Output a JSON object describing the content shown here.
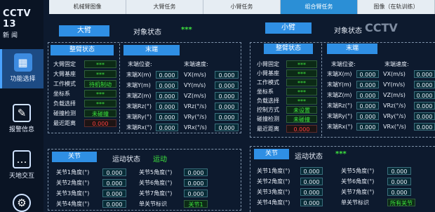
{
  "tabs": [
    "机械臂图像",
    "大臂任务",
    "小臂任务",
    "组合臂任务",
    "图像（在轨训练）"
  ],
  "tab_active_index": 3,
  "logo": {
    "main": "CCTV 13",
    "sub": "新闻"
  },
  "sidebar": [
    {
      "label": "功能选择",
      "icon": "grid-icon"
    },
    {
      "label": "报警信息",
      "icon": "document-icon"
    },
    {
      "label": "天地交互",
      "icon": "chat-icon"
    },
    {
      "label": "",
      "icon": "gear-icon"
    }
  ],
  "watermark": "CCTV",
  "big_arm": {
    "name": "大臂",
    "object_status_label": "对象状态",
    "object_status_value": "***",
    "whole_status": {
      "title": "整臂状态",
      "rows": [
        {
          "label": "大臂固定",
          "value": "***"
        },
        {
          "label": "大臂基座",
          "value": "***"
        },
        {
          "label": "工作模式",
          "value": "待机制动"
        },
        {
          "label": "坐标系",
          "value": "***"
        },
        {
          "label": "负载选择",
          "value": "***"
        },
        {
          "label": "碰撞检测",
          "value": "未碰撞"
        },
        {
          "label": "最近距离",
          "value": "0.000"
        }
      ]
    },
    "end": {
      "title": "末端",
      "pos_title": "末端位姿:",
      "vel_title": "末端速度:",
      "pos": [
        {
          "label": "末端X(m)",
          "value": "0.000"
        },
        {
          "label": "末端Y(m)",
          "value": "0.000"
        },
        {
          "label": "末端Z(m)",
          "value": "0.000"
        },
        {
          "label": "末端Rz(°)",
          "value": "0.000"
        },
        {
          "label": "末端Ry(°)",
          "value": "0.000"
        },
        {
          "label": "末端Rx(°)",
          "value": "0.000"
        }
      ],
      "vel": [
        {
          "label": "VX(m/s)",
          "value": "0.000"
        },
        {
          "label": "VY(m/s)",
          "value": "0.000"
        },
        {
          "label": "VZ(m/s)",
          "value": "0.000"
        },
        {
          "label": "VRz(°/s)",
          "value": "0.000"
        },
        {
          "label": "VRy(°/s)",
          "value": "0.000"
        },
        {
          "label": "VRx(°/s)",
          "value": "0.000"
        }
      ]
    },
    "joint": {
      "title": "关节",
      "motion_label": "运动状态",
      "motion_value": "运动",
      "left": [
        {
          "label": "关节1角度(°)",
          "value": "0.000"
        },
        {
          "label": "关节2角度(°)",
          "value": "0.000"
        },
        {
          "label": "关节3角度(°)",
          "value": "0.000"
        },
        {
          "label": "关节4角度(°)",
          "value": "0.000"
        }
      ],
      "right": [
        {
          "label": "关节5角度(°)",
          "value": "0.000"
        },
        {
          "label": "关节6角度(°)",
          "value": "0.000"
        },
        {
          "label": "关节7角度(°)",
          "value": "0.000"
        },
        {
          "label": "单关节标识",
          "value": "关节1"
        }
      ]
    }
  },
  "small_arm": {
    "name": "小臂",
    "object_status_label": "对象状态",
    "object_status_value": "***",
    "whole_status": {
      "title": "整臂状态",
      "rows": [
        {
          "label": "小臂固定",
          "value": "***"
        },
        {
          "label": "小臂基座",
          "value": "***"
        },
        {
          "label": "工作模式",
          "value": "***"
        },
        {
          "label": "坐标系",
          "value": "***"
        },
        {
          "label": "负载选择",
          "value": "***"
        },
        {
          "label": "控制方式",
          "value": "未设置"
        },
        {
          "label": "碰撞检测",
          "value": "未碰撞"
        },
        {
          "label": "最近距离",
          "value": "0.000"
        }
      ]
    },
    "end": {
      "title": "末端",
      "pos_title": "末端位姿:",
      "vel_title": "末端速度:",
      "pos": [
        {
          "label": "末端X(m)",
          "value": "0.000"
        },
        {
          "label": "末端Y(m)",
          "value": "0.000"
        },
        {
          "label": "末端Z(m)",
          "value": "0.000"
        },
        {
          "label": "末端Rz(°)",
          "value": "0.000"
        },
        {
          "label": "末端Ry(°)",
          "value": "0.000"
        },
        {
          "label": "末端Rx(°)",
          "value": "0.000"
        }
      ],
      "vel": [
        {
          "label": "VX(m/s)",
          "value": "0.000"
        },
        {
          "label": "VY(m/s)",
          "value": "0.000"
        },
        {
          "label": "VZ(m/s)",
          "value": "0.000"
        },
        {
          "label": "VRz(°/s)",
          "value": "0.000"
        },
        {
          "label": "VRy(°/s)",
          "value": "0.000"
        },
        {
          "label": "VRx(°/s)",
          "value": "0.000"
        }
      ]
    },
    "joint": {
      "title": "关节",
      "motion_label": "运动状态",
      "motion_value": "***",
      "left": [
        {
          "label": "关节1角度(°)",
          "value": "0.000"
        },
        {
          "label": "关节2角度(°)",
          "value": "0.000"
        },
        {
          "label": "关节3角度(°)",
          "value": "0.000"
        },
        {
          "label": "关节4角度(°)",
          "value": "0.000"
        }
      ],
      "right": [
        {
          "label": "关节5角度(°)",
          "value": "0.000"
        },
        {
          "label": "关节6角度(°)",
          "value": "0.000"
        },
        {
          "label": "关节7角度(°)",
          "value": "0.000"
        },
        {
          "label": "单关节标识",
          "value": "所有关节"
        }
      ]
    }
  }
}
